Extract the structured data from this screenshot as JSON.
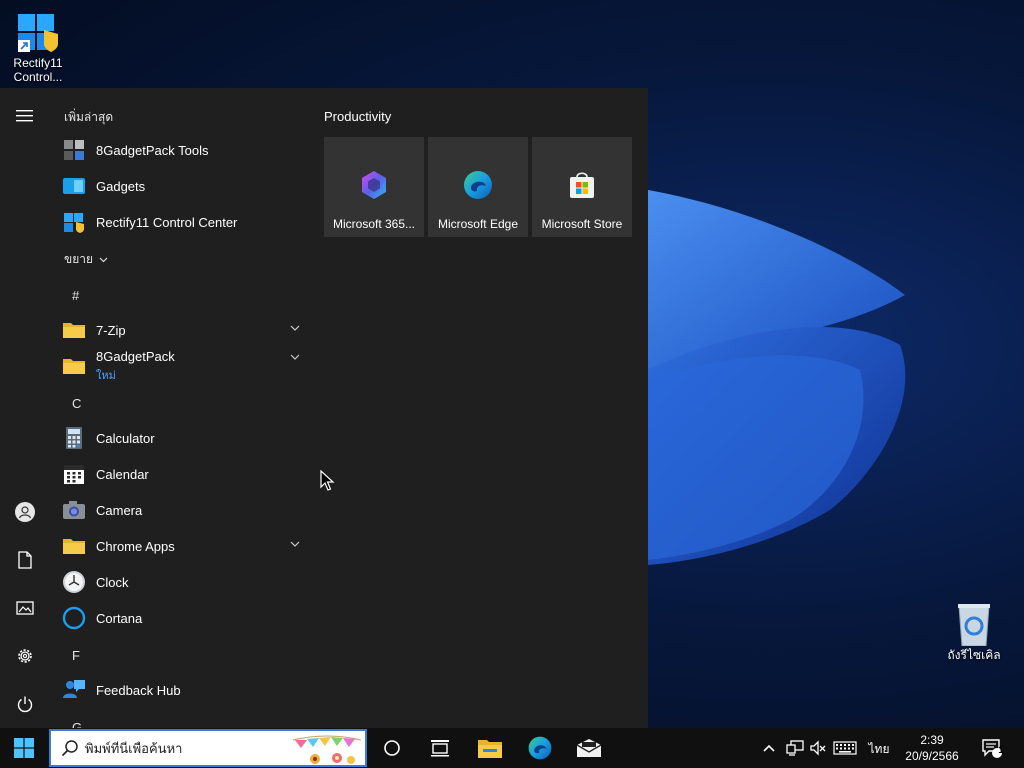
{
  "desktop": {
    "shortcut_label": "Rectify11 Control...",
    "recycle_label": "ถังรีไซเคิล"
  },
  "start_menu": {
    "recent_header": "เพิ่มล่าสุด",
    "expand_label": "ขยาย",
    "recent_apps": [
      {
        "label": "8GadgetPack Tools",
        "icon": "gadgetpack-tools-icon"
      },
      {
        "label": "Gadgets",
        "icon": "gadgets-icon"
      },
      {
        "label": "Rectify11 Control Center",
        "icon": "rectify11-icon"
      }
    ],
    "letters": [
      "#",
      "C",
      "F",
      "G"
    ],
    "apps": [
      {
        "label": "7-Zip",
        "icon": "folder-icon"
      },
      {
        "label": "8GadgetPack",
        "sub": "ใหม่",
        "icon": "folder-icon"
      },
      {
        "label": "Calculator",
        "icon": "calculator-icon"
      },
      {
        "label": "Calendar",
        "icon": "calendar-icon"
      },
      {
        "label": "Camera",
        "icon": "camera-icon"
      },
      {
        "label": "Chrome Apps",
        "icon": "folder-icon"
      },
      {
        "label": "Clock",
        "icon": "clock-icon"
      },
      {
        "label": "Cortana",
        "icon": "cortana-icon"
      },
      {
        "label": "Feedback Hub",
        "icon": "feedback-icon"
      }
    ],
    "tiles_group": "Productivity",
    "tiles": [
      {
        "label": "Microsoft 365...",
        "icon": "m365-icon"
      },
      {
        "label": "Microsoft Edge",
        "icon": "edge-icon"
      },
      {
        "label": "Microsoft Store",
        "icon": "store-icon"
      }
    ]
  },
  "taskbar": {
    "search_placeholder": "พิมพ์ที่นี่เพื่อค้นหา",
    "language": "ไทย",
    "time": "2:39",
    "date": "20/9/2566",
    "notification_count": "1"
  },
  "colors": {
    "menu_bg": "#1f1f1f",
    "tile_bg": "#333333",
    "accent": "#0078d4",
    "new_badge": "#4aa3ff"
  }
}
